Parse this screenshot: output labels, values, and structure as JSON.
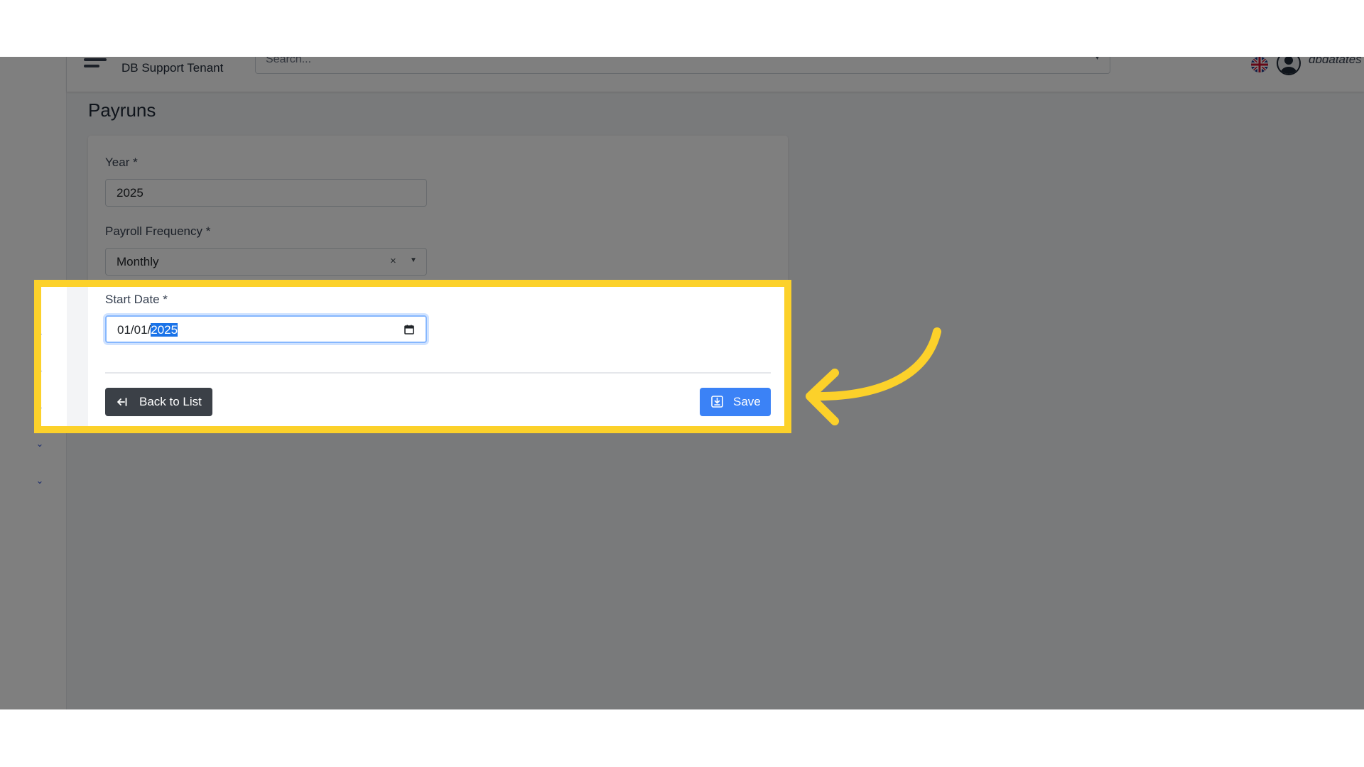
{
  "header": {
    "tenant": "DB Support Tenant",
    "search_placeholder": "Search...",
    "username": "dbdatates"
  },
  "page": {
    "title": "Payruns"
  },
  "form": {
    "year_label": "Year *",
    "year_value": "2025",
    "frequency_label": "Payroll Frequency *",
    "frequency_value": "Monthly",
    "frequency_clear": "×",
    "start_date_label": "Start Date *",
    "start_date_prefix": "01/01/",
    "start_date_selected": "2025",
    "back_label": "Back to List",
    "save_label": "Save"
  },
  "icons": {
    "menu": "hamburger-icon",
    "flag": "uk-flag-icon",
    "user": "user-avatar-icon",
    "calendar": "calendar-icon",
    "back": "back-arrow-icon",
    "save": "save-icon",
    "chevron": "chevron-down-icon"
  },
  "colors": {
    "highlight": "#fcd12a",
    "save_button": "#3b82f6",
    "back_button": "#3b4047",
    "overlay": "rgba(0,0,0,0.5)"
  }
}
